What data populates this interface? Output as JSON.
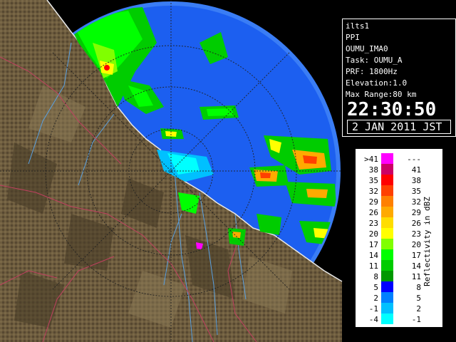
{
  "info": {
    "lines": [
      "ilts1",
      "PPI",
      "OUMU_IMA0",
      "Task: OUMU_A",
      "PRF: 1800Hz",
      "Elevation:1.0",
      "Max Range:80 km"
    ],
    "time": "22:30:50",
    "date": "2 JAN 2011 JST"
  },
  "legend": {
    "axis_label": "Reflectivity in dBZ",
    "rows": [
      {
        "lo": ">41",
        "hi": "---",
        "color": "#ff00ff"
      },
      {
        "lo": "38",
        "hi": "41",
        "color": "#cc0066"
      },
      {
        "lo": "35",
        "hi": "38",
        "color": "#ff0000"
      },
      {
        "lo": "32",
        "hi": "35",
        "color": "#ff4000"
      },
      {
        "lo": "29",
        "hi": "32",
        "color": "#ff8000"
      },
      {
        "lo": "26",
        "hi": "29",
        "color": "#ffaa00"
      },
      {
        "lo": "23",
        "hi": "26",
        "color": "#ffdd00"
      },
      {
        "lo": "20",
        "hi": "23",
        "color": "#ffff00"
      },
      {
        "lo": "17",
        "hi": "20",
        "color": "#80ff00"
      },
      {
        "lo": "14",
        "hi": "17",
        "color": "#00ff00"
      },
      {
        "lo": "11",
        "hi": "14",
        "color": "#00cc00"
      },
      {
        "lo": "8",
        "hi": "11",
        "color": "#009900"
      },
      {
        "lo": "5",
        "hi": "8",
        "color": "#0000ff"
      },
      {
        "lo": "2",
        "hi": "5",
        "color": "#0080ff"
      },
      {
        "lo": "-1",
        "hi": "2",
        "color": "#00c0ff"
      },
      {
        "lo": "-4",
        "hi": "-1",
        "color": "#00ffff"
      }
    ]
  },
  "colors": {
    "land": "#6b5a3c",
    "land_dark": "#4a3d28",
    "radar_bg": "#1c5ff0",
    "radar_edge": "#3a7df5",
    "sea_outside": "#000000",
    "rivers": "#5aa0e0",
    "borders": "#c04060",
    "coast": "#e0e0e0"
  }
}
